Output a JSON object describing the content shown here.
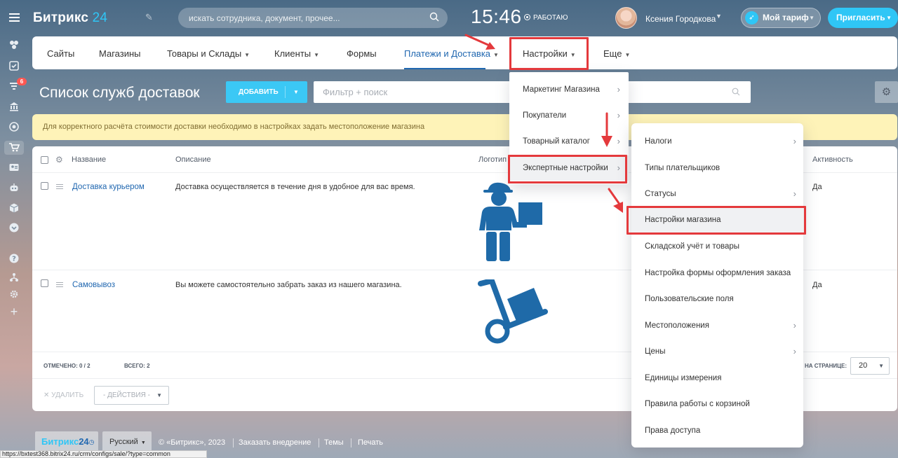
{
  "app": {
    "logo_text": "Битрикс",
    "logo_num": "24",
    "search_placeholder": "искать сотрудника, документ, прочее...",
    "clock": "15:46",
    "work_status": "РАБОТАЮ",
    "user_name": "Ксения Городкова",
    "tariff_label": "Мой тариф",
    "invite_label": "Пригласить"
  },
  "left_rail": {
    "badge_count": "6",
    "icons": [
      "flower-icon",
      "tasks-icon",
      "filter-icon",
      "bank-icon",
      "target-icon",
      "cart-icon",
      "contact-card-icon",
      "robot-icon",
      "cube-icon",
      "chevron-down-circle-icon",
      "help-icon",
      "structure-icon",
      "gear-icon",
      "plus-icon"
    ]
  },
  "nav": {
    "items": [
      {
        "label": "Сайты",
        "caret": false
      },
      {
        "label": "Магазины",
        "caret": false
      },
      {
        "label": "Товары и Склады",
        "caret": true
      },
      {
        "label": "Клиенты",
        "caret": true
      },
      {
        "label": "Формы",
        "caret": false
      },
      {
        "label": "Платежи и Доставка",
        "caret": true,
        "active": true
      },
      {
        "label": "Настройки",
        "caret": true
      },
      {
        "label": "Еще",
        "caret": true
      }
    ]
  },
  "page": {
    "title": "Список служб доставок",
    "add_button": "ДОБАВИТЬ",
    "filter_placeholder": "Фильтр + поиск",
    "warning": "Для корректного расчёта стоимости доставки необходимо в настройках задать местоположение магазина"
  },
  "grid": {
    "columns": {
      "name": "Название",
      "description": "Описание",
      "logo": "Логотип",
      "active": "Активность"
    },
    "rows": [
      {
        "name": "Доставка курьером",
        "description": "Доставка осуществляется в течение дня в удобное для вас время.",
        "logo": "courier-icon",
        "active": "Да"
      },
      {
        "name": "Самовывоз",
        "description": "Вы можете самостоятельно забрать заказ из нашего магазина.",
        "logo": "hand-truck-icon",
        "active": "Да"
      }
    ],
    "marked_label": "ОТМЕЧЕНО:",
    "marked_value": "0 / 2",
    "total_label": "ВСЕГО:",
    "total_value": "2",
    "per_page_label": "НА СТРАНИЦЕ:",
    "per_page_value": "20",
    "delete_label": "УДАЛИТЬ",
    "actions_label": "- ДЕЙСТВИЯ -"
  },
  "menu_settings": {
    "items": [
      {
        "label": "Маркетинг Магазина",
        "sub": true
      },
      {
        "label": "Покупатели",
        "sub": true
      },
      {
        "label": "Товарный каталог",
        "sub": true
      },
      {
        "label": "Экспертные настройки",
        "sub": true
      }
    ]
  },
  "menu_expert": {
    "items": [
      {
        "label": "Налоги",
        "sub": true
      },
      {
        "label": "Типы плательщиков",
        "sub": false
      },
      {
        "label": "Статусы",
        "sub": true
      },
      {
        "label": "Настройки магазина",
        "sub": false
      },
      {
        "label": "Складской учёт и товары",
        "sub": false
      },
      {
        "label": "Настройка формы оформления заказа",
        "sub": false
      },
      {
        "label": "Пользовательские поля",
        "sub": false
      },
      {
        "label": "Местоположения",
        "sub": true
      },
      {
        "label": "Цены",
        "sub": true
      },
      {
        "label": "Единицы измерения",
        "sub": false
      },
      {
        "label": "Правила работы с корзиной",
        "sub": false
      },
      {
        "label": "Права доступа",
        "sub": false
      }
    ]
  },
  "footer": {
    "logo_text": "Битрикс",
    "logo_num": "24",
    "language": "Русский",
    "copyright": "© «Битрикс», 2023",
    "order_impl": "Заказать внедрение",
    "themes": "Темы",
    "print": "Печать",
    "status_url": "https://bxtest368.bitrix24.ru/crm/configs/sale/?type=common"
  },
  "colors": {
    "accent": "#2fc6f6",
    "link": "#2067b0",
    "highlight": "#e4393c",
    "warning_bg": "#fef3b8",
    "logo_blue": "#1f6aa8"
  }
}
